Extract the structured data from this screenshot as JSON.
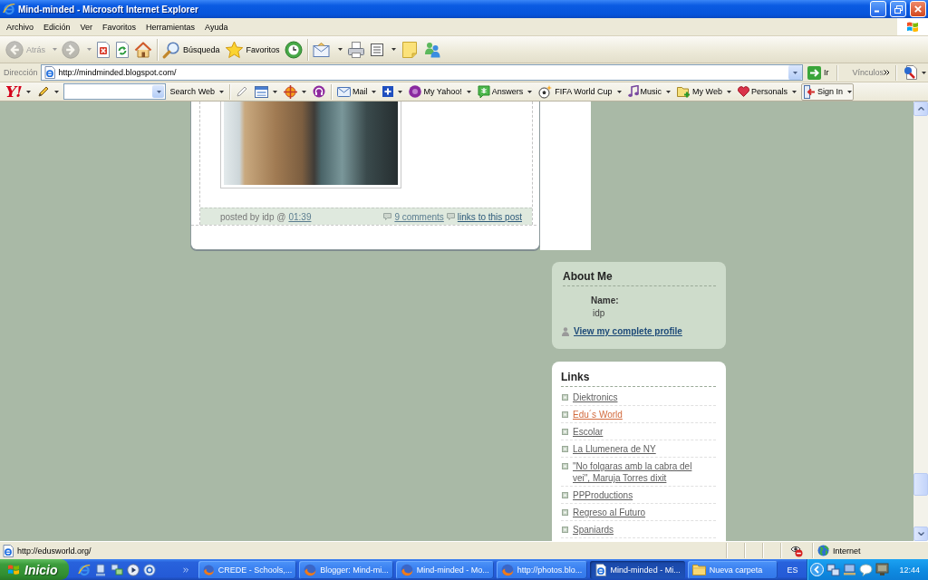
{
  "window": {
    "title": "Mind-minded - Microsoft Internet Explorer"
  },
  "menu": [
    "Archivo",
    "Edición",
    "Ver",
    "Favoritos",
    "Herramientas",
    "Ayuda"
  ],
  "toolbar": [
    [
      {
        "kind": "back",
        "label": "Atrás",
        "disabled": true,
        "dropdown": true
      },
      {
        "kind": "forward",
        "disabled": true,
        "dropdown": true
      },
      {
        "kind": "stop",
        "disabled": false,
        "dropdown": false
      },
      {
        "kind": "refresh",
        "disabled": false,
        "dropdown": false
      },
      {
        "kind": "home",
        "disabled": false,
        "dropdown": false
      }
    ],
    [
      {
        "kind": "search",
        "label": "Búsqueda",
        "disabled": false,
        "dropdown": false
      },
      {
        "kind": "favorites",
        "label": "Favoritos",
        "disabled": false,
        "dropdown": false
      },
      {
        "kind": "history",
        "disabled": false,
        "dropdown": false
      }
    ],
    [
      {
        "kind": "mail",
        "disabled": false,
        "dropdown": true
      },
      {
        "kind": "print",
        "disabled": false,
        "dropdown": false
      },
      {
        "kind": "word",
        "disabled": false,
        "dropdown": true
      },
      {
        "kind": "note",
        "disabled": false,
        "dropdown": false
      },
      {
        "kind": "messenger",
        "disabled": false,
        "dropdown": false
      }
    ]
  ],
  "address": {
    "label": "Dirección",
    "url": "http://mindminded.blogspot.com/",
    "go": "Ir",
    "links": "Vínculos"
  },
  "yahoo_toolbar": [
    [
      {
        "kind": "logo",
        "label": "Y!",
        "dropdown": true
      },
      {
        "kind": "pencil",
        "dropdown": true
      },
      {
        "kind": "search_field",
        "dropdown": true
      },
      {
        "kind": "search_button",
        "label": "Search Web",
        "dropdown": true
      }
    ],
    [
      {
        "kind": "highlighter",
        "dropdown": false
      },
      {
        "kind": "layout",
        "dropdown": true
      },
      {
        "kind": "crosshair",
        "dropdown": true
      },
      {
        "kind": "podcast",
        "dropdown": false
      }
    ],
    [
      {
        "kind": "mail",
        "label": "Mail",
        "dropdown": true
      },
      {
        "kind": "plus",
        "dropdown": true
      },
      {
        "kind": "myyahoo",
        "label": "My Yahoo!",
        "dropdown": true
      },
      {
        "kind": "answers",
        "label": "Answers",
        "dropdown": true
      },
      {
        "kind": "fifa",
        "label": "FIFA World Cup",
        "dropdown": true
      },
      {
        "kind": "music",
        "label": "Music",
        "dropdown": true
      },
      {
        "kind": "myweb",
        "label": "My Web",
        "dropdown": true
      },
      {
        "kind": "personals",
        "label": "Personals",
        "dropdown": true
      },
      {
        "kind": "signin",
        "label": "Sign In",
        "dropdown": true
      }
    ]
  ],
  "post": {
    "byline": "posted by idp @",
    "time": "01:39",
    "comments": "9 comments",
    "backlinks": "links to this post"
  },
  "sidebar": {
    "about": {
      "title": "About Me",
      "name_label": "Name:",
      "name": "idp",
      "profile_link": "View my complete profile"
    },
    "links": {
      "title": "Links",
      "items": [
        {
          "label": "Diektronics",
          "hovered": false
        },
        {
          "label": "Edu´s World",
          "hovered": true
        },
        {
          "label": "Escolar",
          "hovered": false
        },
        {
          "label": "La Llumenera de NY",
          "hovered": false
        },
        {
          "label": "\"No folgaras amb la cabra del vei\", Maruja Torres dixit",
          "hovered": false
        },
        {
          "label": "PPProductions",
          "hovered": false
        },
        {
          "label": "Regreso al Futuro",
          "hovered": false
        },
        {
          "label": "Spaniards",
          "hovered": false
        }
      ]
    }
  },
  "status_bar": {
    "text": "http://edusworld.org/",
    "zone": "Internet"
  },
  "taskbar": {
    "start": "Inicio",
    "tasks": [
      {
        "kind": "firefox",
        "label": "CREDE - Schools,...",
        "selected": false
      },
      {
        "kind": "firefox",
        "label": "Blogger: Mind-mi...",
        "selected": false
      },
      {
        "kind": "firefox",
        "label": "Mind-minded - Mo...",
        "selected": false
      },
      {
        "kind": "firefox",
        "label": "http://photos.blo...",
        "selected": false
      },
      {
        "kind": "ie",
        "label": "Mind-minded - Mi...",
        "selected": true
      },
      {
        "kind": "folder",
        "label": "Nueva carpeta",
        "selected": false
      }
    ],
    "language": "ES",
    "clock": "12:44"
  }
}
